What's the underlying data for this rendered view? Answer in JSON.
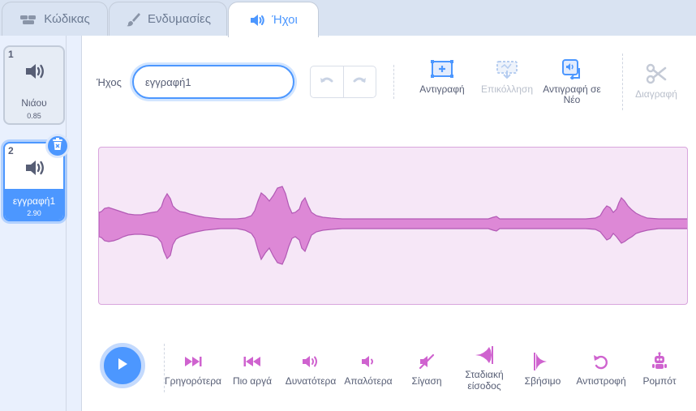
{
  "tabs": [
    {
      "label": "Κώδικας",
      "icon": "code-icon"
    },
    {
      "label": "Ενδυμασίες",
      "icon": "paintbrush-icon"
    },
    {
      "label": "Ήχοι",
      "icon": "speaker-icon",
      "active": true
    }
  ],
  "sounds": [
    {
      "number": "1",
      "name": "Νιάου",
      "duration": "0.85",
      "icon": "speaker-icon"
    },
    {
      "number": "2",
      "name": "εγγραφή1",
      "duration": "2.90",
      "icon": "speaker-icon",
      "selected": true
    }
  ],
  "editor": {
    "sound_label": "Ήχος",
    "sound_name_value": "εγγραφή1",
    "tools": {
      "copy": "Αντιγραφή",
      "paste": "Επικόλληση",
      "copy_to_new": "Αντιγραφή σε Νέο",
      "delete": "Διαγραφή"
    },
    "waveform": {
      "fill_color": "#dd88d6",
      "stroke_color": "#b25ab5",
      "background": "#f6e7f7"
    }
  },
  "effects": [
    {
      "label": "Γρηγορότερα",
      "icon": "faster-icon"
    },
    {
      "label": "Πιο αργά",
      "icon": "slower-icon"
    },
    {
      "label": "Δυνατότερα",
      "icon": "louder-icon"
    },
    {
      "label": "Απαλότερα",
      "icon": "softer-icon"
    },
    {
      "label": "Σίγαση",
      "icon": "mute-icon"
    },
    {
      "label": "Σταδιακή είσοδος",
      "icon": "fade-in-icon"
    },
    {
      "label": "Σβήσιμο",
      "icon": "fade-out-icon"
    },
    {
      "label": "Αντιστροφή",
      "icon": "reverse-icon"
    },
    {
      "label": "Ρομπότ",
      "icon": "robot-icon"
    }
  ],
  "colors": {
    "accent": "#4c97ff",
    "effect": "#cf63cf"
  }
}
